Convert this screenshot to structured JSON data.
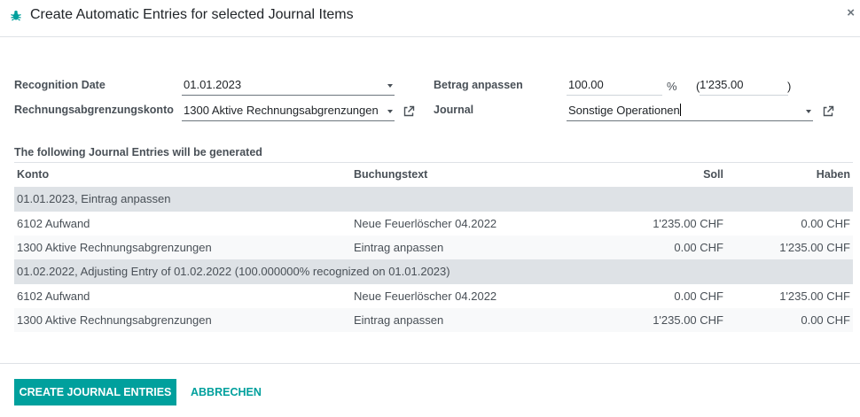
{
  "dialog": {
    "title": "Create Automatic Entries for selected Journal Items",
    "close_glyph": "×",
    "icon": "bug-icon"
  },
  "form": {
    "recognition_date_label": "Recognition Date",
    "recognition_date_value": "01.01.2023",
    "account_label": "Rechnungsabgrenzungskonto",
    "account_value": "1300 Aktive Rechnungsabgrenzungen",
    "percentage_label": "Betrag anpassen",
    "percentage_value": "100.00",
    "percent_sign": "%",
    "paren_open": "(",
    "amount_value": "1'235.00",
    "paren_close": ")",
    "journal_label": "Journal",
    "journal_value": "Sonstige Operationen"
  },
  "entries": {
    "section_title": "The following Journal Entries will be generated",
    "columns": [
      "Konto",
      "Buchungstext",
      "Soll",
      "Haben"
    ],
    "groups": [
      {
        "title": "01.01.2023, Eintrag anpassen",
        "lines": [
          {
            "account": "6102 Aufwand",
            "label": "Neue Feuerlöscher 04.2022",
            "debit": "1'235.00 CHF",
            "credit": "0.00 CHF"
          },
          {
            "account": "1300 Aktive Rechnungsabgrenzungen",
            "label": "Eintrag anpassen",
            "debit": "0.00 CHF",
            "credit": "1'235.00 CHF"
          }
        ]
      },
      {
        "title": "01.02.2022, Adjusting Entry of 01.02.2022 (100.000000% recognized on 01.01.2023)",
        "lines": [
          {
            "account": "6102 Aufwand",
            "label": "Neue Feuerlöscher 04.2022",
            "debit": "0.00 CHF",
            "credit": "1'235.00 CHF"
          },
          {
            "account": "1300 Aktive Rechnungsabgrenzungen",
            "label": "Eintrag anpassen",
            "debit": "1'235.00 CHF",
            "credit": "0.00 CHF"
          }
        ]
      }
    ]
  },
  "footer": {
    "create_label": "CREATE JOURNAL ENTRIES",
    "cancel_label": "ABBRECHEN"
  },
  "colors": {
    "primary": "#00a09d",
    "group_row": "#dee2e6",
    "alt_row": "#f8f9fa"
  }
}
